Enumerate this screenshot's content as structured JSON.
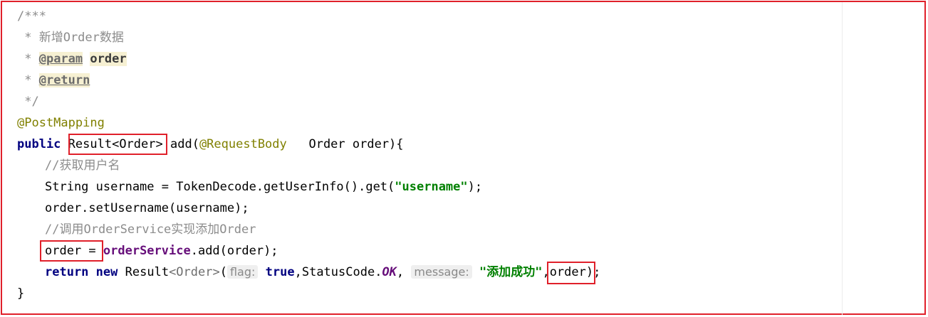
{
  "editor": {
    "lines": {
      "l1": "/***",
      "l2": " * 新增Order数据",
      "l3_star": " * ",
      "l3_tag": "@param",
      "l3_name": "order",
      "l4_star": " * ",
      "l4_tag": "@return",
      "l5": " */",
      "l6": "@PostMapping",
      "l7_kw": "public",
      "l7_type": "Result<Order>",
      "l7_method": "add(",
      "l7_ann": "@RequestBody",
      "l7_rest": "   Order order){",
      "l8": "//获取用户名",
      "l9_a": "String username = TokenDecode.getUserInfo().get(",
      "l9_str": "\"username\"",
      "l9_b": ");",
      "l10": "order.setUsername(username);",
      "l11": "//调用OrderService实现添加Order",
      "l12_a": "order = ",
      "l12_field": "orderService",
      "l12_b": ".add(order);",
      "l13_kw1": "return",
      "l13_kw2": "new",
      "l13_cls": "Result",
      "l13_gen": "<Order>",
      "l13_paren": "(",
      "l13_hint1": "flag:",
      "l13_true": "true",
      "l13_mid": ",StatusCode.",
      "l13_ok": "OK",
      "l13_comma": ",",
      "l13_hint2": "message:",
      "l13_str": "\"添加成功\"",
      "l13_arg": ",order",
      "l13_end": ");",
      "l14": "}"
    }
  },
  "colors": {
    "highlight_box": "#e0202a",
    "keyword": "#000080",
    "string": "#008000",
    "annotation": "#808000",
    "field": "#660e7a",
    "comment": "#8c8c8c"
  }
}
